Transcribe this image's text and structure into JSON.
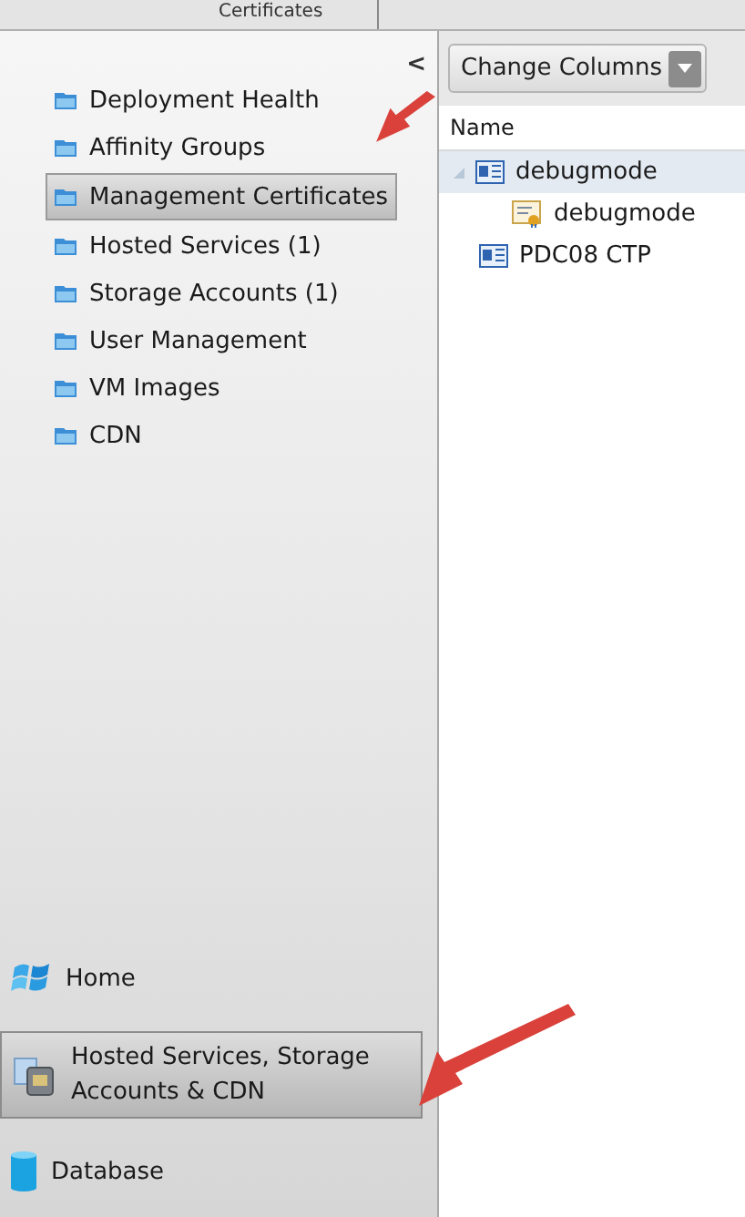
{
  "top_tab": {
    "label": "Certificates"
  },
  "sidebar": {
    "items": [
      {
        "label": "Deployment Health",
        "selected": false
      },
      {
        "label": "Affinity Groups",
        "selected": false
      },
      {
        "label": "Management Certificates",
        "selected": true
      },
      {
        "label": "Hosted Services (1)",
        "selected": false
      },
      {
        "label": "Storage Accounts (1)",
        "selected": false
      },
      {
        "label": "User Management",
        "selected": false
      },
      {
        "label": "VM Images",
        "selected": false
      },
      {
        "label": "CDN",
        "selected": false
      }
    ],
    "collapse": "<",
    "nav": [
      {
        "label": "Home",
        "kind": "home",
        "selected": false
      },
      {
        "label": "Hosted Services, Storage Accounts & CDN",
        "kind": "services",
        "selected": true
      },
      {
        "label": "Database",
        "kind": "database",
        "selected": false
      }
    ]
  },
  "toolbar": {
    "button": "Change Columns"
  },
  "table": {
    "columns": [
      "Name"
    ],
    "rows": [
      {
        "label": "debugmode",
        "kind": "subscription",
        "expanded": true,
        "selected": true,
        "children": [
          {
            "label": "debugmode",
            "kind": "certificate",
            "selected": false
          }
        ]
      },
      {
        "label": "PDC08 CTP",
        "kind": "subscription",
        "selected": false
      }
    ]
  }
}
